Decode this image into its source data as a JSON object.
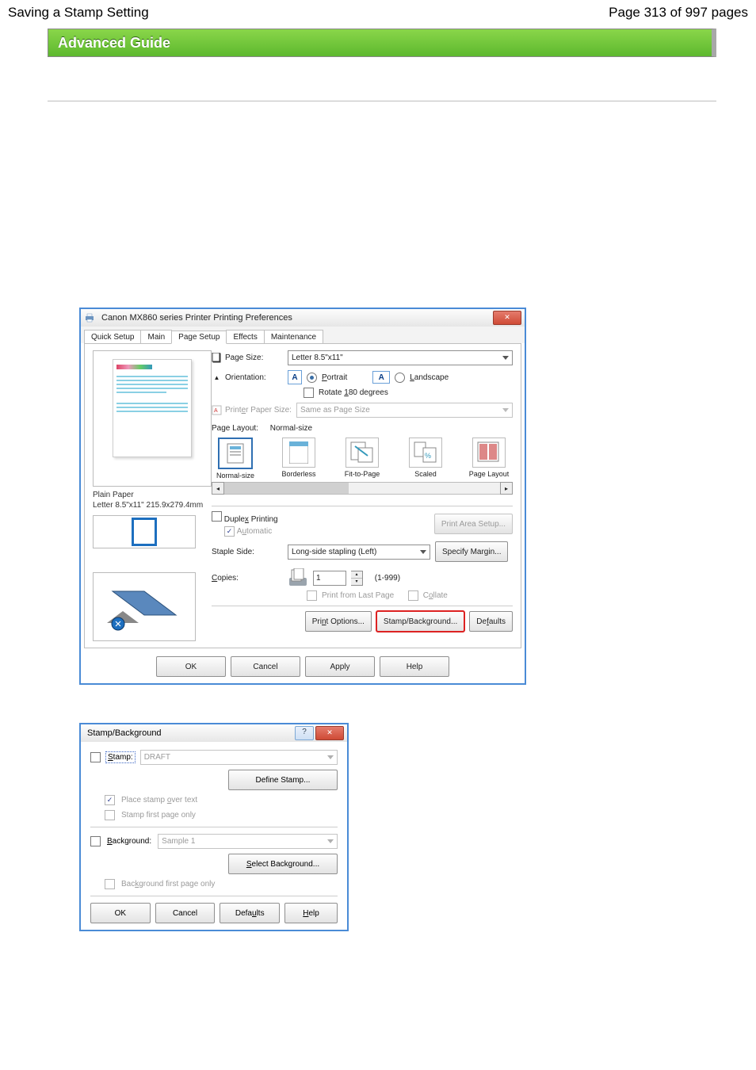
{
  "header": {
    "title": "Saving a Stamp Setting",
    "page_counter": "Page 313 of 997 pages"
  },
  "banner": {
    "title": "Advanced Guide"
  },
  "dialog1": {
    "title": "Canon MX860 series Printer Printing Preferences",
    "tabs": [
      "Quick Setup",
      "Main",
      "Page Setup",
      "Effects",
      "Maintenance"
    ],
    "preview_caption_line1": "Plain Paper",
    "preview_caption_line2": "Letter 8.5\"x11\" 215.9x279.4mm",
    "page_size_label": "Page Size:",
    "page_size_value": "Letter 8.5\"x11\"",
    "orientation_label": "Orientation:",
    "portrait_label": "Portrait",
    "landscape_label": "Landscape",
    "rotate_label": "Rotate 180 degrees",
    "printer_paper_label": "Printer Paper Size:",
    "printer_paper_value": "Same as Page Size",
    "page_layout_label": "Page Layout:",
    "page_layout_value": "Normal-size",
    "layouts": [
      "Normal-size",
      "Borderless",
      "Fit-to-Page",
      "Scaled",
      "Page Layout"
    ],
    "duplex_label": "Duplex Printing",
    "automatic_label": "Automatic",
    "print_area_btn": "Print Area Setup...",
    "staple_label": "Staple Side:",
    "staple_value": "Long-side stapling (Left)",
    "specify_margin_btn": "Specify Margin...",
    "copies_label": "Copies:",
    "copies_value": "1",
    "copies_range": "(1-999)",
    "print_from_last_label": "Print from Last Page",
    "collate_label": "Collate",
    "print_options_btn": "Print Options...",
    "stamp_bg_btn": "Stamp/Background...",
    "defaults_btn": "Defaults",
    "ok_btn": "OK",
    "cancel_btn": "Cancel",
    "apply_btn": "Apply",
    "help_btn": "Help"
  },
  "dialog2": {
    "title": "Stamp/Background",
    "stamp_label": "Stamp:",
    "stamp_value": "DRAFT",
    "define_stamp_btn": "Define Stamp...",
    "place_over_label": "Place stamp over text",
    "stamp_first_label": "Stamp first page only",
    "background_label": "Background:",
    "background_value": "Sample 1",
    "select_bg_btn": "Select Background...",
    "bg_first_label": "Background first page only",
    "ok_btn": "OK",
    "cancel_btn": "Cancel",
    "defaults_btn": "Defaults",
    "help_btn": "Help"
  }
}
